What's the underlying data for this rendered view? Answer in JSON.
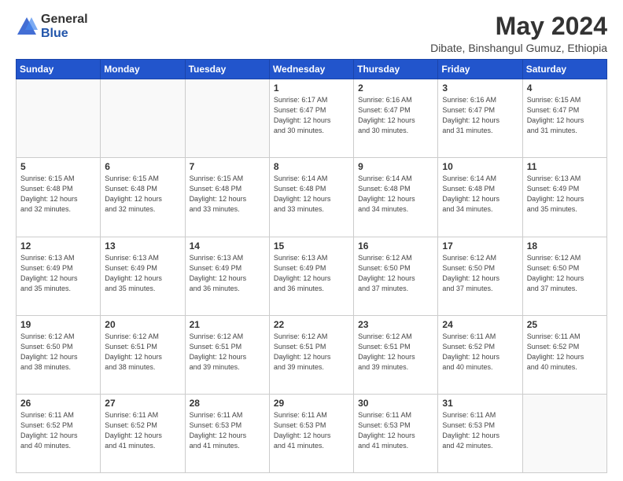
{
  "logo": {
    "general": "General",
    "blue": "Blue"
  },
  "header": {
    "title": "May 2024",
    "subtitle": "Dibate, Binshangul Gumuz, Ethiopia"
  },
  "weekdays": [
    "Sunday",
    "Monday",
    "Tuesday",
    "Wednesday",
    "Thursday",
    "Friday",
    "Saturday"
  ],
  "weeks": [
    [
      {
        "day": "",
        "info": ""
      },
      {
        "day": "",
        "info": ""
      },
      {
        "day": "",
        "info": ""
      },
      {
        "day": "1",
        "info": "Sunrise: 6:17 AM\nSunset: 6:47 PM\nDaylight: 12 hours\nand 30 minutes."
      },
      {
        "day": "2",
        "info": "Sunrise: 6:16 AM\nSunset: 6:47 PM\nDaylight: 12 hours\nand 30 minutes."
      },
      {
        "day": "3",
        "info": "Sunrise: 6:16 AM\nSunset: 6:47 PM\nDaylight: 12 hours\nand 31 minutes."
      },
      {
        "day": "4",
        "info": "Sunrise: 6:15 AM\nSunset: 6:47 PM\nDaylight: 12 hours\nand 31 minutes."
      }
    ],
    [
      {
        "day": "5",
        "info": "Sunrise: 6:15 AM\nSunset: 6:48 PM\nDaylight: 12 hours\nand 32 minutes."
      },
      {
        "day": "6",
        "info": "Sunrise: 6:15 AM\nSunset: 6:48 PM\nDaylight: 12 hours\nand 32 minutes."
      },
      {
        "day": "7",
        "info": "Sunrise: 6:15 AM\nSunset: 6:48 PM\nDaylight: 12 hours\nand 33 minutes."
      },
      {
        "day": "8",
        "info": "Sunrise: 6:14 AM\nSunset: 6:48 PM\nDaylight: 12 hours\nand 33 minutes."
      },
      {
        "day": "9",
        "info": "Sunrise: 6:14 AM\nSunset: 6:48 PM\nDaylight: 12 hours\nand 34 minutes."
      },
      {
        "day": "10",
        "info": "Sunrise: 6:14 AM\nSunset: 6:48 PM\nDaylight: 12 hours\nand 34 minutes."
      },
      {
        "day": "11",
        "info": "Sunrise: 6:13 AM\nSunset: 6:49 PM\nDaylight: 12 hours\nand 35 minutes."
      }
    ],
    [
      {
        "day": "12",
        "info": "Sunrise: 6:13 AM\nSunset: 6:49 PM\nDaylight: 12 hours\nand 35 minutes."
      },
      {
        "day": "13",
        "info": "Sunrise: 6:13 AM\nSunset: 6:49 PM\nDaylight: 12 hours\nand 35 minutes."
      },
      {
        "day": "14",
        "info": "Sunrise: 6:13 AM\nSunset: 6:49 PM\nDaylight: 12 hours\nand 36 minutes."
      },
      {
        "day": "15",
        "info": "Sunrise: 6:13 AM\nSunset: 6:49 PM\nDaylight: 12 hours\nand 36 minutes."
      },
      {
        "day": "16",
        "info": "Sunrise: 6:12 AM\nSunset: 6:50 PM\nDaylight: 12 hours\nand 37 minutes."
      },
      {
        "day": "17",
        "info": "Sunrise: 6:12 AM\nSunset: 6:50 PM\nDaylight: 12 hours\nand 37 minutes."
      },
      {
        "day": "18",
        "info": "Sunrise: 6:12 AM\nSunset: 6:50 PM\nDaylight: 12 hours\nand 37 minutes."
      }
    ],
    [
      {
        "day": "19",
        "info": "Sunrise: 6:12 AM\nSunset: 6:50 PM\nDaylight: 12 hours\nand 38 minutes."
      },
      {
        "day": "20",
        "info": "Sunrise: 6:12 AM\nSunset: 6:51 PM\nDaylight: 12 hours\nand 38 minutes."
      },
      {
        "day": "21",
        "info": "Sunrise: 6:12 AM\nSunset: 6:51 PM\nDaylight: 12 hours\nand 39 minutes."
      },
      {
        "day": "22",
        "info": "Sunrise: 6:12 AM\nSunset: 6:51 PM\nDaylight: 12 hours\nand 39 minutes."
      },
      {
        "day": "23",
        "info": "Sunrise: 6:12 AM\nSunset: 6:51 PM\nDaylight: 12 hours\nand 39 minutes."
      },
      {
        "day": "24",
        "info": "Sunrise: 6:11 AM\nSunset: 6:52 PM\nDaylight: 12 hours\nand 40 minutes."
      },
      {
        "day": "25",
        "info": "Sunrise: 6:11 AM\nSunset: 6:52 PM\nDaylight: 12 hours\nand 40 minutes."
      }
    ],
    [
      {
        "day": "26",
        "info": "Sunrise: 6:11 AM\nSunset: 6:52 PM\nDaylight: 12 hours\nand 40 minutes."
      },
      {
        "day": "27",
        "info": "Sunrise: 6:11 AM\nSunset: 6:52 PM\nDaylight: 12 hours\nand 41 minutes."
      },
      {
        "day": "28",
        "info": "Sunrise: 6:11 AM\nSunset: 6:53 PM\nDaylight: 12 hours\nand 41 minutes."
      },
      {
        "day": "29",
        "info": "Sunrise: 6:11 AM\nSunset: 6:53 PM\nDaylight: 12 hours\nand 41 minutes."
      },
      {
        "day": "30",
        "info": "Sunrise: 6:11 AM\nSunset: 6:53 PM\nDaylight: 12 hours\nand 41 minutes."
      },
      {
        "day": "31",
        "info": "Sunrise: 6:11 AM\nSunset: 6:53 PM\nDaylight: 12 hours\nand 42 minutes."
      },
      {
        "day": "",
        "info": ""
      }
    ]
  ]
}
